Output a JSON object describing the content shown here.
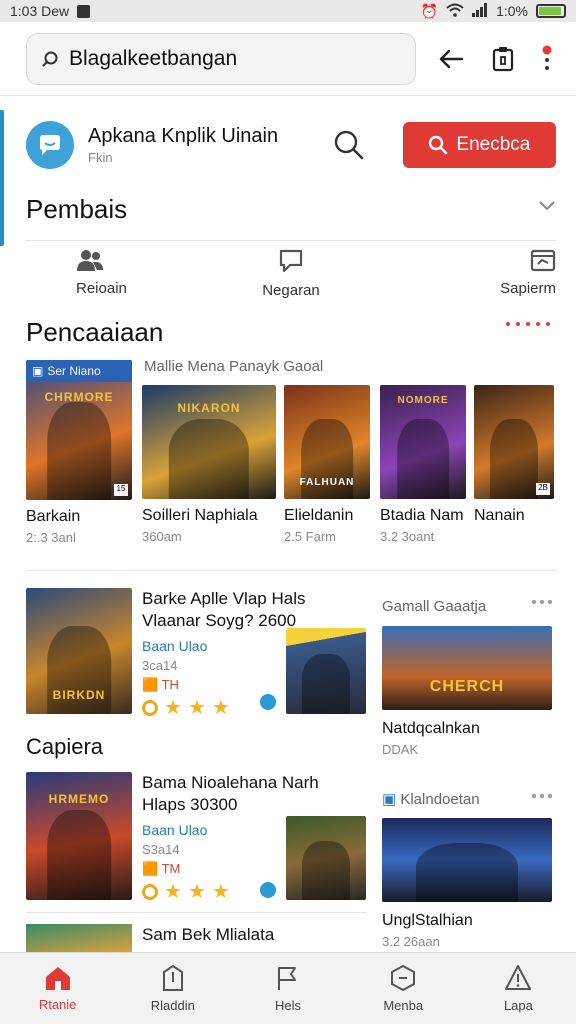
{
  "status": {
    "time": "1:03 Dew",
    "battery": "1:0%",
    "battery_level": 0.9
  },
  "search": {
    "placeholder": "Blagalkeetbangan"
  },
  "app": {
    "name": "Apkana Knplik Uinain",
    "sub": "Fkin",
    "button": "Enecbca"
  },
  "sections": {
    "pembais": "Pembais",
    "pencaaiaan": "Pencaaiaan",
    "capiera": "Capiera"
  },
  "tabs": [
    {
      "label": "Reioain",
      "icon": "people-icon"
    },
    {
      "label": "Negaran",
      "icon": "chat-icon"
    },
    {
      "label": "Sapierm",
      "icon": "folder-icon"
    }
  ],
  "games_header": "Mallie Mena Panayk Gaoal",
  "games": [
    {
      "title": "Barkain",
      "meta": "2:.3 3anl",
      "badge": "Ser Niano",
      "logo": "CHRMORE",
      "colors": [
        "#2d4a8a",
        "#e0742a"
      ]
    },
    {
      "title": "Soilleri Naphiala",
      "meta": "360am",
      "logo": "NIKARON",
      "colors": [
        "#1c3a6a",
        "#d9a236"
      ]
    },
    {
      "title": "Elieldanin",
      "meta": "2.5 Farm",
      "logo": "FALHUAN",
      "colors": [
        "#7a3218",
        "#e0862a"
      ]
    },
    {
      "title": "Btadia Nam",
      "meta": "3.2 3oant",
      "logo": "NOMORE",
      "colors": [
        "#3a2050",
        "#8b44b5"
      ]
    },
    {
      "title": "Nanain",
      "meta": "",
      "logo": "",
      "colors": [
        "#3a2418",
        "#d27a2a"
      ]
    }
  ],
  "cards": [
    {
      "title": "Barke Aplle Vlap Hals Vlaanar Soyg? 2600",
      "tag": "Baan Ulao",
      "meta": "3ca14",
      "rating_icons": 3,
      "extra": "TH"
    },
    {
      "title": "Bama Nioalehana Narh Hlaps 30300",
      "tag": "Baan Ulao",
      "meta": "S3a14",
      "rating_icons": 3,
      "extra": "TM"
    }
  ],
  "side_items": [
    {
      "label": "Gamall Gaaatja",
      "title": "Natdqcalnkan",
      "meta": "DDAK",
      "logo": "CHERCH"
    },
    {
      "label": "Klalndoetan",
      "title": "UnglStalhian",
      "meta": "3.2 26aan",
      "logo": ""
    }
  ],
  "bottom_nav": [
    {
      "label": "Rtanie",
      "icon": "home-icon",
      "active": true
    },
    {
      "label": "Rladdin",
      "icon": "building-icon",
      "active": false
    },
    {
      "label": "Hels",
      "icon": "flag-icon",
      "active": false
    },
    {
      "label": "Menba",
      "icon": "badge-icon",
      "active": false
    },
    {
      "label": "Lapa",
      "icon": "alert-icon",
      "active": false
    }
  ]
}
